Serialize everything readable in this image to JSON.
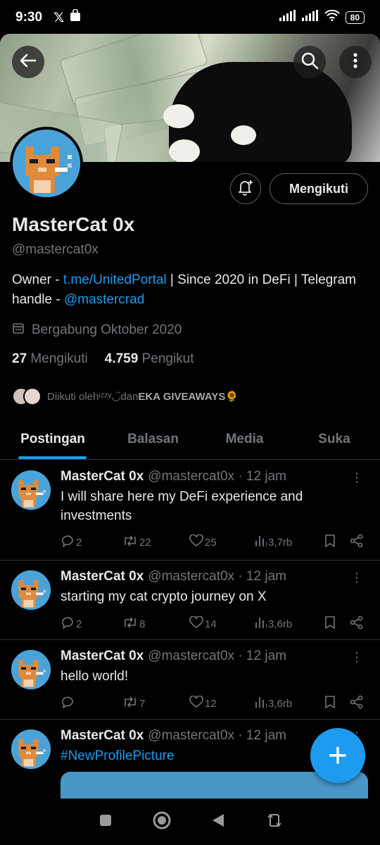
{
  "status_bar": {
    "time": "9:30",
    "battery": "80"
  },
  "header": {
    "back_icon": "arrow-left-icon",
    "search_icon": "search-icon",
    "more_icon": "more-vertical-icon"
  },
  "profile": {
    "name": "MasterCat 0x",
    "handle": "@mastercat0x",
    "bio_prefix": "Owner - ",
    "bio_link": "t.me/UnitedPortal",
    "bio_middle": " | Since 2020 in DeFi | Telegram handle - ",
    "bio_mention": "@mastercrad",
    "joined": "Bergabung Oktober 2020",
    "following_count": "27",
    "following_label": "Mengikuti",
    "followers_count": "4.759",
    "followers_label": "Pengikut",
    "followed_by_prefix": "Diikuti oleh ",
    "followed_by_user1": "ᶦᶻᶻʸ◡̈",
    "followed_by_middle": "dan ",
    "followed_by_user2": "EKA GIVEAWAYS🌻",
    "follow_button": "Mengikuti"
  },
  "tabs": [
    {
      "label": "Postingan",
      "active": true
    },
    {
      "label": "Balasan",
      "active": false
    },
    {
      "label": "Media",
      "active": false
    },
    {
      "label": "Suka",
      "active": false
    }
  ],
  "tweets": [
    {
      "name": "MasterCat 0x",
      "handle": "@mastercat0x · 12 jam",
      "text": "I will share here my DeFi experience and investments",
      "replies": "2",
      "retweets": "22",
      "likes": "25",
      "views": "3,7rb"
    },
    {
      "name": "MasterCat 0x",
      "handle": "@mastercat0x · 12 jam",
      "text": "starting my cat crypto journey on X",
      "replies": "2",
      "retweets": "8",
      "likes": "14",
      "views": "3,6rb"
    },
    {
      "name": "MasterCat 0x",
      "handle": "@mastercat0x · 12 jam",
      "text": "hello world!",
      "replies": "",
      "retweets": "7",
      "likes": "12",
      "views": "3,6rb"
    },
    {
      "name": "MasterCat 0x",
      "handle": "@mastercat0x · 12 jam",
      "text": "#NewProfilePicture"
    }
  ],
  "fab": {
    "label": "+"
  },
  "colors": {
    "accent": "#1d9bf0",
    "background": "#000000",
    "muted": "#71767b"
  }
}
